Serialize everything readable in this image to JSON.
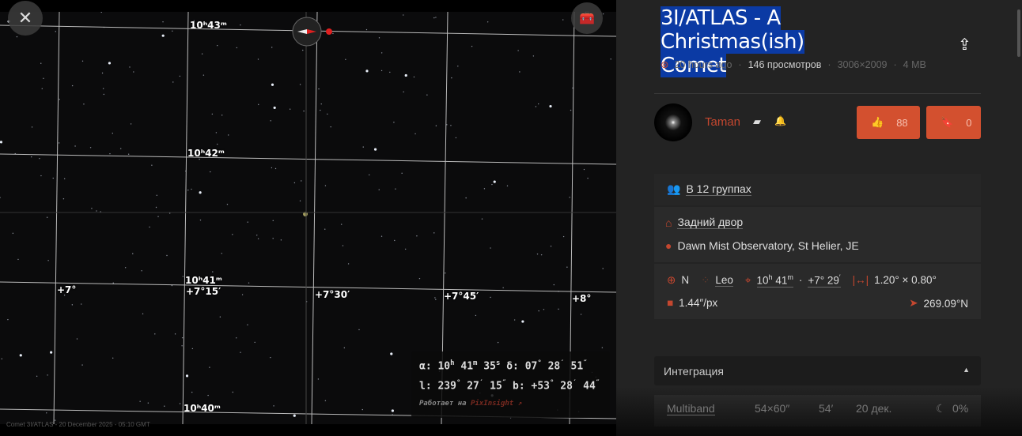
{
  "viewer": {
    "close_icon": "close-icon",
    "tools_icon": "toolbox-icon",
    "grid_labels": {
      "ra": [
        "10ʰ43ᵐ",
        "10ʰ42ᵐ",
        "10ʰ41ᵐ",
        "10ʰ40ᵐ"
      ],
      "dec": [
        "+7°",
        "+7°15′",
        "+7°30′",
        "+7°45′",
        "+8°"
      ]
    },
    "coords": {
      "alpha_label": "α:",
      "alpha_h": "10",
      "alpha_m": "41",
      "alpha_s": "35",
      "delta_label": "δ:",
      "delta_d": "07",
      "delta_m": "28",
      "delta_s": "51",
      "l_label": "l:",
      "l_d": "239",
      "l_m": "27",
      "l_s": "15",
      "b_label": "b:",
      "b_d": "+53",
      "b_m": "28",
      "b_s": "44",
      "powered": "Работает на",
      "powered_brand": "PixInsight ↗"
    },
    "caption": "Comet 3I/ATLAS - 20 December 2025 - 05:10 GMT"
  },
  "panel": {
    "title_line1": "3I/ATLAS - A Christmas(ish)",
    "title_line2": "Comet",
    "meta": {
      "time": "20 hours ago",
      "views": "146 просмотров",
      "resolution": "3006×2009",
      "size": "4 MB"
    },
    "author": "Taman",
    "likes": "88",
    "bookmarks": "0",
    "groups": "В 12 группах",
    "location_name": "Задний двор",
    "location_place": "Dawn Mist Observatory, St Helier, JE",
    "hemisphere": "N",
    "constellation": "Leo",
    "ra_h": "10",
    "ra_m": "41",
    "dec": "+7° 29",
    "fov": "1.20° × 0.80°",
    "scale": "1.44″/px",
    "orientation": "269.09°N",
    "integration_label": "Интеграция",
    "multiband": {
      "filter": "Multiband",
      "exposure": "54×60″",
      "total": "54′",
      "date": "20 дек.",
      "moon": "0%"
    }
  },
  "colors": {
    "accent": "#d3502f",
    "bg": "#232323"
  }
}
